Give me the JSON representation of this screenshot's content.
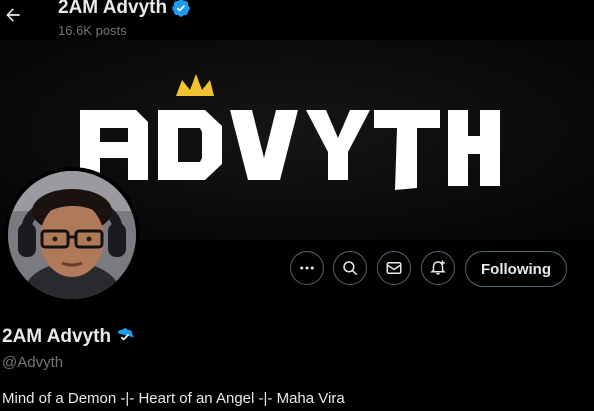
{
  "header": {
    "title": "2AM Advyth",
    "post_count": "16.6K posts"
  },
  "banner": {
    "wordmark": "ADVYTH",
    "crown_color": "#f2c230"
  },
  "profile": {
    "display_name": "2AM Advyth",
    "handle": "@Advyth",
    "bio": "Mind of a Demon -|- Heart of an Angel -|- Maha Vira"
  },
  "actions": {
    "more_icon": "more-dots-icon",
    "search_icon": "search-icon",
    "message_icon": "envelope-icon",
    "notify_icon": "bell-plus-icon",
    "following_label": "Following"
  },
  "colors": {
    "verified": "#1d9bf0",
    "border": "#536471",
    "muted_text": "#71767b"
  }
}
